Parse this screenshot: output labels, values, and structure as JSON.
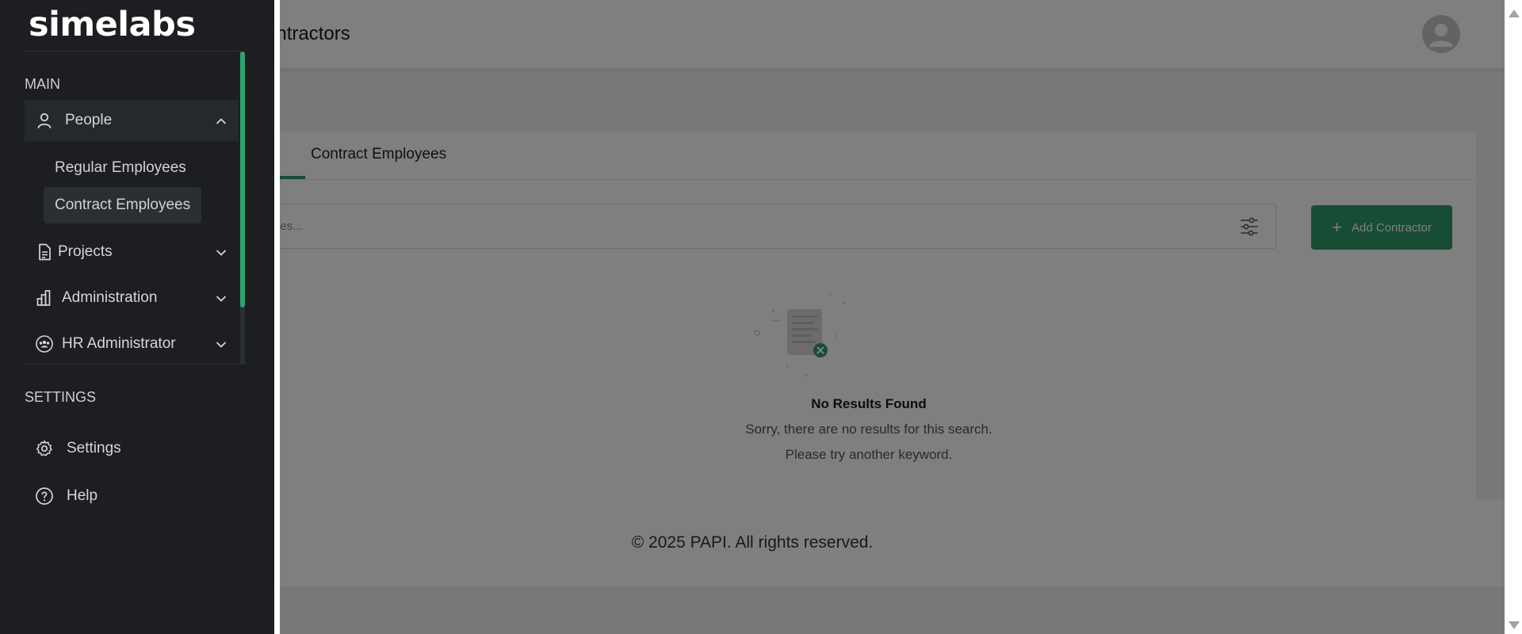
{
  "header": {
    "title": "ontractors"
  },
  "tabs": {
    "contract_label": "Contract Employees"
  },
  "search": {
    "placeholder": "ees...",
    "filter_icon": "sliders-icon"
  },
  "actions": {
    "add_label": "Add Contractor",
    "add_icon": "plus-icon"
  },
  "empty_state": {
    "title": "No Results Found",
    "line1": "Sorry, there are no results for this search.",
    "line2": "Please try another keyword."
  },
  "footer": {
    "text": "© 2025 PAPI. All rights reserved."
  },
  "sidebar": {
    "logo": "simelabs",
    "section_main": "MAIN",
    "section_settings": "SETTINGS",
    "items": [
      {
        "label": "People",
        "icon": "user-icon",
        "expanded": true
      },
      {
        "label": "Projects",
        "icon": "document-icon",
        "expanded": false
      },
      {
        "label": "Administration",
        "icon": "bar-chart-icon",
        "expanded": false
      },
      {
        "label": "HR Administrator",
        "icon": "group-icon",
        "expanded": false
      }
    ],
    "people_sub": [
      {
        "label": "Regular Employees",
        "active": false
      },
      {
        "label": "Contract Employees",
        "active": true
      }
    ],
    "settings_items": [
      {
        "label": "Settings",
        "icon": "gear-icon"
      },
      {
        "label": "Help",
        "icon": "help-circle-icon"
      }
    ]
  },
  "colors": {
    "accent": "#2f9b6a",
    "sidebar_bg": "#1c1e22",
    "overlay": "rgba(0,0,0,0.5)"
  }
}
